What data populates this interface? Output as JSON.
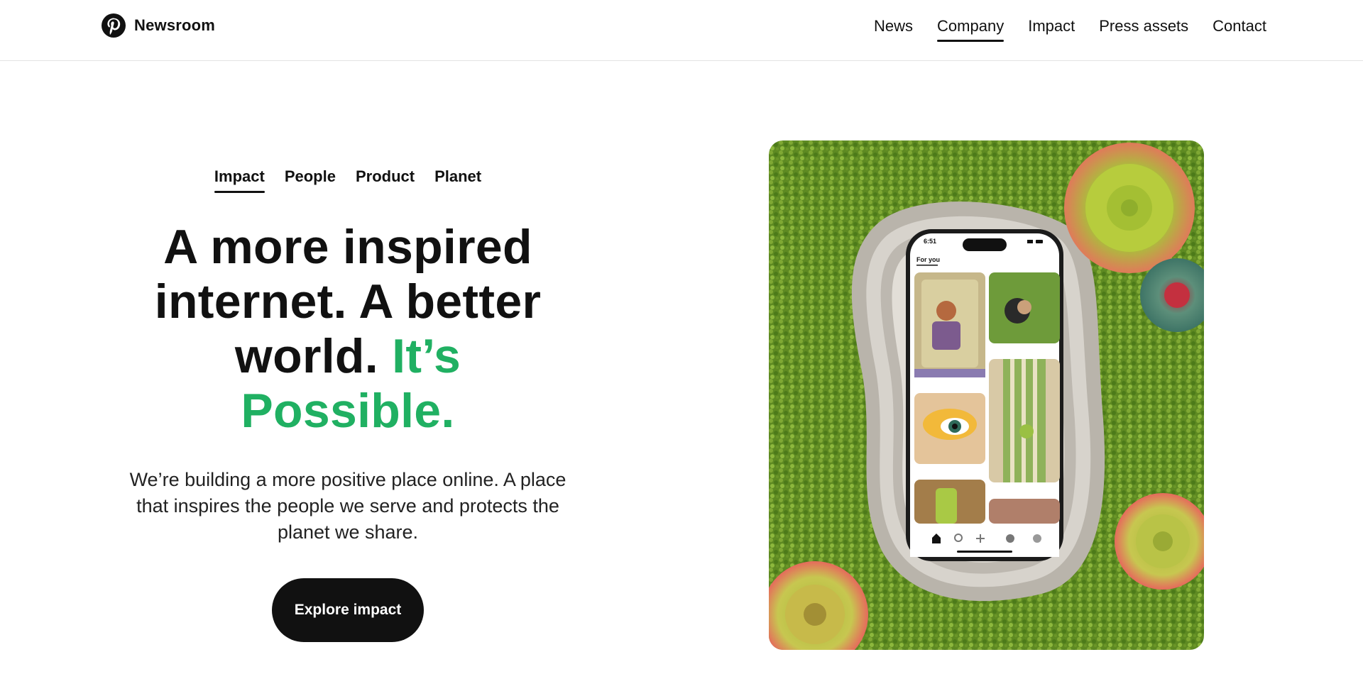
{
  "header": {
    "brand": "Newsroom",
    "brand_icon": "pinterest-logo-icon",
    "nav": [
      {
        "label": "News",
        "active": false
      },
      {
        "label": "Company",
        "active": true
      },
      {
        "label": "Impact",
        "active": false
      },
      {
        "label": "Press assets",
        "active": false
      },
      {
        "label": "Contact",
        "active": false
      }
    ]
  },
  "hero": {
    "tabs": [
      {
        "label": "Impact",
        "active": true
      },
      {
        "label": "People",
        "active": false
      },
      {
        "label": "Product",
        "active": false
      },
      {
        "label": "Planet",
        "active": false
      }
    ],
    "headline_part1": "A more inspired internet. A better world.",
    "headline_accent": "It’s Possible.",
    "description": "We’re building a more positive place online. A place that inspires the people we serve and protects the planet we share.",
    "cta_label": "Explore impact"
  },
  "phone": {
    "time": "6:51",
    "tab": "For you"
  },
  "colors": {
    "accent_green": "#20b062",
    "text": "#111111",
    "button_bg": "#111111"
  }
}
